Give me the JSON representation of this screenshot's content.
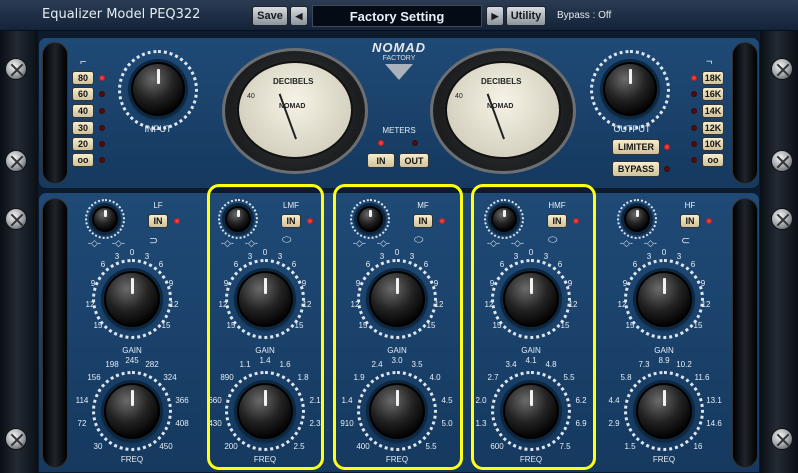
{
  "header": {
    "title": "Equalizer Model PEQ322",
    "save_label": "Save",
    "preset_name": "Factory Setting",
    "utility_label": "Utility",
    "bypass_status": "Bypass : Off",
    "prev_arrow": "◀",
    "next_arrow": "▶"
  },
  "logo": {
    "name": "NOMAD",
    "sub": "FACTORY"
  },
  "input_section": {
    "label": "INPUT",
    "hpf_buttons": [
      "80",
      "60",
      "40",
      "30",
      "20",
      "oo"
    ]
  },
  "output_section": {
    "label": "OUTPUT",
    "lpf_buttons": [
      "18K",
      "16K",
      "14K",
      "12K",
      "10K",
      "oo"
    ],
    "limiter_label": "LIMITER",
    "bypass_label": "BYPASS"
  },
  "meters": {
    "label": "METERS",
    "in_label": "IN",
    "out_label": "OUT",
    "face_title": "DECIBELS",
    "face_brand": "NOMAD",
    "scale_left": "40",
    "scale_right": "40"
  },
  "bands": [
    {
      "name": "LF",
      "in_label": "IN",
      "gain_label": "GAIN",
      "freq_label": "FREQ",
      "gain_scale": [
        "0",
        "3",
        "3",
        "6",
        "6",
        "9",
        "9",
        "12",
        "12",
        "15",
        "15"
      ],
      "freq_scale": [
        "245",
        "198",
        "282",
        "156",
        "324",
        "114",
        "366",
        "72",
        "408",
        "30",
        "450"
      ]
    },
    {
      "name": "LMF",
      "in_label": "IN",
      "gain_label": "GAIN",
      "freq_label": "FREQ",
      "gain_scale": [
        "0",
        "3",
        "3",
        "6",
        "6",
        "9",
        "9",
        "12",
        "12",
        "15",
        "15"
      ],
      "freq_scale": [
        "1.4",
        "1.1",
        "1.6",
        "890",
        "1.8",
        "660",
        "2.1",
        "430",
        "2.3",
        "200",
        "2.5"
      ]
    },
    {
      "name": "MF",
      "in_label": "IN",
      "gain_label": "GAIN",
      "freq_label": "FREQ",
      "gain_scale": [
        "0",
        "3",
        "3",
        "6",
        "6",
        "9",
        "9",
        "12",
        "12",
        "15",
        "15"
      ],
      "freq_scale": [
        "3.0",
        "2.4",
        "3.5",
        "1.9",
        "4.0",
        "1.4",
        "4.5",
        "910",
        "5.0",
        "400",
        "5.5"
      ]
    },
    {
      "name": "HMF",
      "in_label": "IN",
      "gain_label": "GAIN",
      "freq_label": "FREQ",
      "gain_scale": [
        "0",
        "3",
        "3",
        "6",
        "6",
        "9",
        "9",
        "12",
        "12",
        "15",
        "15"
      ],
      "freq_scale": [
        "4.1",
        "3.4",
        "4.8",
        "2.7",
        "5.5",
        "2.0",
        "6.2",
        "1.3",
        "6.9",
        "600",
        "7.5"
      ]
    },
    {
      "name": "HF",
      "in_label": "IN",
      "gain_label": "GAIN",
      "freq_label": "FREQ",
      "gain_scale": [
        "0",
        "3",
        "3",
        "6",
        "6",
        "9",
        "9",
        "12",
        "12",
        "15",
        "15"
      ],
      "freq_scale": [
        "8.9",
        "7.3",
        "10.2",
        "5.8",
        "11.6",
        "4.4",
        "13.1",
        "2.9",
        "14.6",
        "1.5",
        "16"
      ]
    }
  ],
  "colors": {
    "panel": "#1f4a76",
    "highlight": "#ffff14",
    "led": "#ff3030"
  }
}
